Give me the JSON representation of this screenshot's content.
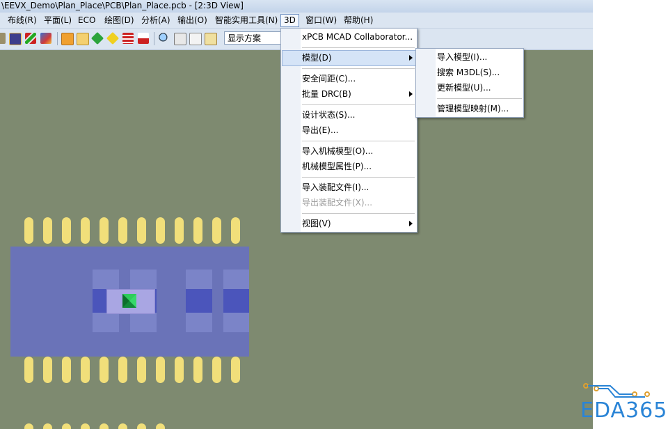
{
  "window": {
    "title": "\\EEVX_Demo\\Plan_Place\\PCB\\Plan_Place.pcb - [2:3D View]"
  },
  "menubar": {
    "items": [
      {
        "label": "布线(R)"
      },
      {
        "label": "平面(L)"
      },
      {
        "label": "ECO"
      },
      {
        "label": "绘图(D)"
      },
      {
        "label": "分析(A)"
      },
      {
        "label": "输出(O)"
      },
      {
        "label": "智能实用工具(N)"
      },
      {
        "label": "3D"
      },
      {
        "label": "窗口(W)"
      },
      {
        "label": "帮助(H)"
      }
    ]
  },
  "toolbar": {
    "display_scheme": "显示方案"
  },
  "menu_3d": {
    "items": [
      {
        "label": "xPCB MCAD Collaborator..."
      },
      {
        "label": "模型(D)"
      },
      {
        "label": "安全间距(C)..."
      },
      {
        "label": "批量 DRC(B)"
      },
      {
        "label": "设计状态(S)..."
      },
      {
        "label": "导出(E)..."
      },
      {
        "label": "导入机械模型(O)..."
      },
      {
        "label": "机械模型属性(P)..."
      },
      {
        "label": "导入装配文件(I)..."
      },
      {
        "label": "导出装配文件(X)..."
      },
      {
        "label": "视图(V)"
      }
    ]
  },
  "submenu_model": {
    "items": [
      {
        "label": "导入模型(I)..."
      },
      {
        "label": "搜索 M3DL(S)..."
      },
      {
        "label": "更新模型(U)..."
      },
      {
        "label": "管理模型映射(M)..."
      }
    ]
  },
  "logo": {
    "text": "EDA365"
  },
  "colors": {
    "canvas": "#7e8a70",
    "pad": "#f1df7a",
    "component_body": "#6a73b8",
    "menubar": "#dbe5f1",
    "logo": "#2a84d6"
  }
}
